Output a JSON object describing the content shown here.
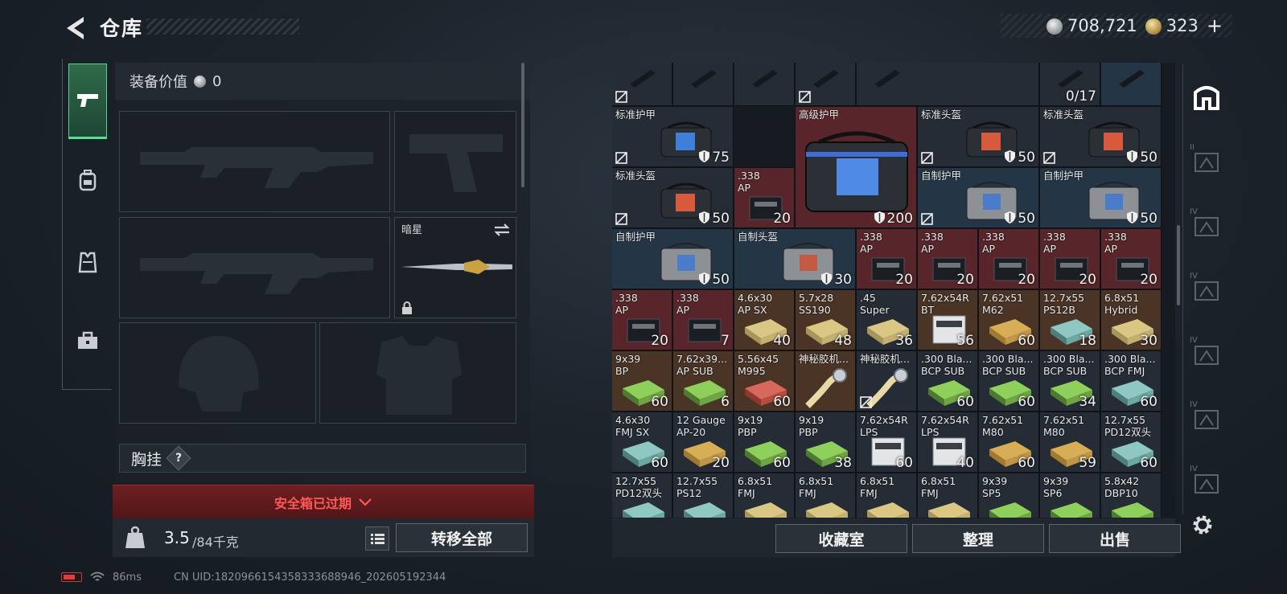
{
  "header": {
    "title": "仓库"
  },
  "currency": {
    "silver": "708,721",
    "gold": "323",
    "add_label": "+"
  },
  "side_tabs": [
    {
      "icon": "pistol-icon",
      "active": true
    },
    {
      "icon": "backpack-icon",
      "active": false
    },
    {
      "icon": "vest-icon",
      "active": false
    },
    {
      "icon": "toolbox-icon",
      "active": false
    }
  ],
  "equipment": {
    "value_label": "装备价值",
    "value": "0",
    "melee_name": "暗星",
    "chest_rig_label": "胸挂",
    "help_label": "?"
  },
  "safe_box": {
    "expired_text": "安全箱已过期"
  },
  "weight": {
    "current": "3.5",
    "capacity": "/84千克"
  },
  "actions": {
    "transfer_all": "转移全部",
    "collection": "收藏室",
    "organize": "整理",
    "sell": "出售"
  },
  "inventory": {
    "top_strip": {
      "qty": "0/17"
    },
    "items": [
      {
        "name": "标准护甲",
        "qty": "75",
        "tone": "def",
        "shield": true,
        "nosell": true,
        "art": "bag-blue"
      },
      {
        "name": "高级护甲",
        "qty": "200",
        "tone": "red",
        "shield": true,
        "nosell": false,
        "art": "bag-big"
      },
      {
        "name": "标准头盔",
        "qty": "50",
        "tone": "def",
        "shield": true,
        "nosell": true,
        "art": "bag-red"
      },
      {
        "name": "标准头盔",
        "qty": "50",
        "tone": "def",
        "shield": true,
        "nosell": true,
        "art": "bag-red"
      },
      {
        "name": "标准头盔",
        "qty": "50",
        "tone": "def",
        "shield": true,
        "nosell": true,
        "art": "bag-red"
      },
      {
        "name": ".338\nAP",
        "qty": "20",
        "tone": "red",
        "shield": false,
        "nosell": false,
        "art": "ammo-dark"
      },
      {
        "name": "自制护甲",
        "qty": "50",
        "tone": "blue",
        "shield": true,
        "nosell": true,
        "art": "bag-gray"
      },
      {
        "name": "自制护甲",
        "qty": "50",
        "tone": "blue",
        "shield": true,
        "nosell": false,
        "art": "bag-gray"
      },
      {
        "name": "自制护甲",
        "qty": "50",
        "tone": "blue",
        "shield": true,
        "nosell": false,
        "art": "bag-gray"
      },
      {
        "name": "自制头盔",
        "qty": "30",
        "tone": "blue",
        "shield": true,
        "nosell": false,
        "art": "bag-gray-red"
      },
      {
        "name": ".338\nAP",
        "qty": "20",
        "tone": "red",
        "art": "ammo-dark"
      },
      {
        "name": ".338\nAP",
        "qty": "20",
        "tone": "red",
        "art": "ammo-dark"
      },
      {
        "name": ".338\nAP",
        "qty": "20",
        "tone": "red",
        "art": "ammo-dark"
      },
      {
        "name": ".338\nAP",
        "qty": "20",
        "tone": "red",
        "art": "ammo-dark"
      },
      {
        "name": ".338\nAP",
        "qty": "20",
        "tone": "red",
        "art": "ammo-dark"
      },
      {
        "name": ".338\nAP",
        "qty": "20",
        "tone": "red",
        "art": "ammo-dark"
      },
      {
        "name": ".338\nAP",
        "qty": "7",
        "tone": "red",
        "art": "ammo-dark"
      },
      {
        "name": "4.6x30\nAP SX",
        "qty": "40",
        "tone": "brown",
        "art": "ammo-yellow"
      },
      {
        "name": "5.7x28\nSS190",
        "qty": "48",
        "tone": "brown",
        "art": "ammo-yellow"
      },
      {
        "name": ".45\nSuper",
        "qty": "36",
        "tone": "def",
        "art": "ammo-yellow"
      },
      {
        "name": "7.62x54R\nBT",
        "qty": "56",
        "tone": "brown",
        "art": "ammo-white"
      },
      {
        "name": "7.62x51\nM62",
        "qty": "60",
        "tone": "brown",
        "art": "ammo-gold"
      },
      {
        "name": "12.7x55\nPS12B",
        "qty": "18",
        "tone": "brown",
        "art": "ammo-teal"
      },
      {
        "name": "6.8x51\nHybrid",
        "qty": "30",
        "tone": "brown",
        "art": "ammo-yellow"
      },
      {
        "name": "9x39\nBP",
        "qty": "60",
        "tone": "brown",
        "art": "ammo-green"
      },
      {
        "name": "7.62x39...\nAP SUB",
        "qty": "6",
        "tone": "brown",
        "art": "ammo-green"
      },
      {
        "name": "5.56x45\nM995",
        "qty": "60",
        "tone": "brown",
        "art": "ammo-red"
      },
      {
        "name": "神秘胶机...",
        "qty": "",
        "tone": "brown",
        "art": "tape"
      },
      {
        "name": "神秘胶机...",
        "qty": "",
        "tone": "def",
        "nosell": true,
        "art": "tape"
      },
      {
        "name": ".300 Bla...\nBCP SUB",
        "qty": "60",
        "tone": "def",
        "art": "ammo-green"
      },
      {
        "name": ".300 Bla...\nBCP SUB",
        "qty": "60",
        "tone": "def",
        "art": "ammo-green"
      },
      {
        "name": ".300 Bla...\nBCP SUB",
        "qty": "34",
        "tone": "def",
        "art": "ammo-green"
      },
      {
        "name": ".300 Bla...\nBCP FMJ",
        "qty": "60",
        "tone": "def",
        "art": "ammo-teal"
      },
      {
        "name": "4.6x30\nFMJ SX",
        "qty": "60",
        "tone": "def",
        "art": "ammo-teal"
      },
      {
        "name": "12 Gauge\nAP-20",
        "qty": "20",
        "tone": "def",
        "art": "ammo-gold"
      },
      {
        "name": "9x19\nPBP",
        "qty": "60",
        "tone": "def",
        "art": "ammo-green"
      },
      {
        "name": "9x19\nPBP",
        "qty": "38",
        "tone": "def",
        "art": "ammo-green"
      },
      {
        "name": "7.62x54R\nLPS",
        "qty": "60",
        "tone": "def",
        "art": "ammo-white"
      },
      {
        "name": "7.62x54R\nLPS",
        "qty": "40",
        "tone": "def",
        "art": "ammo-white"
      },
      {
        "name": "7.62x51\nM80",
        "qty": "60",
        "tone": "def",
        "art": "ammo-gold"
      },
      {
        "name": "7.62x51\nM80",
        "qty": "59",
        "tone": "def",
        "art": "ammo-gold"
      },
      {
        "name": "12.7x55\nPD12双头",
        "qty": "60",
        "tone": "def",
        "art": "ammo-teal"
      },
      {
        "name": "12.7x55\nPD12双头",
        "qty": "",
        "tone": "def",
        "art": "ammo-teal"
      },
      {
        "name": "12.7x55\nPS12",
        "qty": "",
        "tone": "def",
        "art": "ammo-teal"
      },
      {
        "name": "6.8x51\nFMJ",
        "qty": "",
        "tone": "def",
        "art": "ammo-yellow"
      },
      {
        "name": "6.8x51\nFMJ",
        "qty": "",
        "tone": "def",
        "art": "ammo-yellow"
      },
      {
        "name": "6.8x51\nFMJ",
        "qty": "",
        "tone": "def",
        "art": "ammo-yellow"
      },
      {
        "name": "6.8x51\nFMJ",
        "qty": "",
        "tone": "def",
        "art": "ammo-yellow"
      },
      {
        "name": "9x39\nSP5",
        "qty": "",
        "tone": "def",
        "art": "ammo-green"
      },
      {
        "name": "9x39\nSP6",
        "qty": "",
        "tone": "def",
        "art": "ammo-green"
      },
      {
        "name": "5.8x42\nDBP10",
        "qty": "",
        "tone": "def",
        "art": "ammo-green"
      }
    ]
  },
  "right_tabs": [
    "base-icon",
    "storage-tab-2-icon",
    "storage-tab-3-icon",
    "storage-tab-4-icon",
    "storage-tab-5-icon",
    "storage-tab-6-icon",
    "storage-tab-7-icon"
  ],
  "right_tab_labels": [
    "",
    "II",
    "IV",
    "IV",
    "IV",
    "IV",
    "IV"
  ],
  "status": {
    "ping": "86ms",
    "uid": "CN UID:1820966154358333688946_202605192344"
  },
  "colors": {
    "accent_green": "#4fe58f",
    "expired_red": "#ff5a55",
    "cell_red": "#58262a",
    "cell_blue": "#243645",
    "cell_brown": "#4a3426"
  }
}
